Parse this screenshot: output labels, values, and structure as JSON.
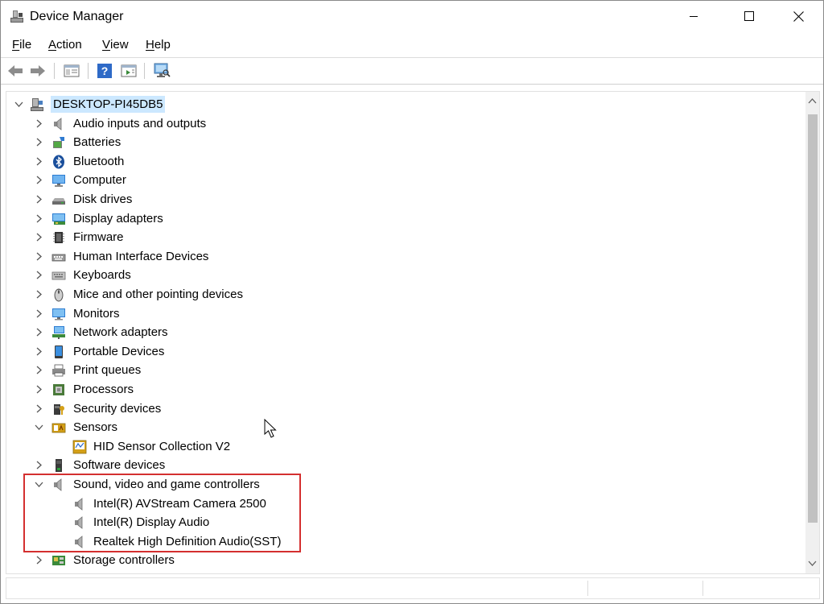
{
  "window": {
    "title": "Device Manager"
  },
  "menu": {
    "items": [
      {
        "key": "F",
        "rest": "ile"
      },
      {
        "key": "A",
        "rest": "ction"
      },
      {
        "key": "V",
        "rest": "iew"
      },
      {
        "key": "H",
        "rest": "elp"
      }
    ]
  },
  "tree": {
    "root": "DESKTOP-PI45DB5",
    "categories": [
      {
        "label": "Audio inputs and outputs",
        "icon": "speaker-icon",
        "expanded": false
      },
      {
        "label": "Batteries",
        "icon": "battery-icon",
        "expanded": false
      },
      {
        "label": "Bluetooth",
        "icon": "bluetooth-icon",
        "expanded": false
      },
      {
        "label": "Computer",
        "icon": "computer-icon",
        "expanded": false
      },
      {
        "label": "Disk drives",
        "icon": "disk-drive-icon",
        "expanded": false
      },
      {
        "label": "Display adapters",
        "icon": "display-adapter-icon",
        "expanded": false
      },
      {
        "label": "Firmware",
        "icon": "firmware-icon",
        "expanded": false
      },
      {
        "label": "Human Interface Devices",
        "icon": "hid-icon",
        "expanded": false
      },
      {
        "label": "Keyboards",
        "icon": "keyboard-icon",
        "expanded": false
      },
      {
        "label": "Mice and other pointing devices",
        "icon": "mouse-icon",
        "expanded": false
      },
      {
        "label": "Monitors",
        "icon": "monitor-icon",
        "expanded": false
      },
      {
        "label": "Network adapters",
        "icon": "network-adapter-icon",
        "expanded": false
      },
      {
        "label": "Portable Devices",
        "icon": "portable-device-icon",
        "expanded": false
      },
      {
        "label": "Print queues",
        "icon": "printer-icon",
        "expanded": false
      },
      {
        "label": "Processors",
        "icon": "processor-icon",
        "expanded": false
      },
      {
        "label": "Security devices",
        "icon": "security-device-icon",
        "expanded": false
      },
      {
        "label": "Sensors",
        "icon": "sensor-icon",
        "expanded": true,
        "children": [
          "HID Sensor Collection V2"
        ]
      },
      {
        "label": "Software devices",
        "icon": "software-device-icon",
        "expanded": false
      },
      {
        "label": "Sound, video and game controllers",
        "icon": "speaker-icon",
        "expanded": true,
        "children": [
          "Intel(R) AVStream Camera 2500",
          "Intel(R) Display Audio",
          "Realtek High Definition Audio(SST)"
        ]
      },
      {
        "label": "Storage controllers",
        "icon": "storage-controller-icon",
        "expanded": false
      }
    ]
  },
  "colors": {
    "selection": "#cce8ff",
    "highlight_box": "#d42f2f"
  }
}
